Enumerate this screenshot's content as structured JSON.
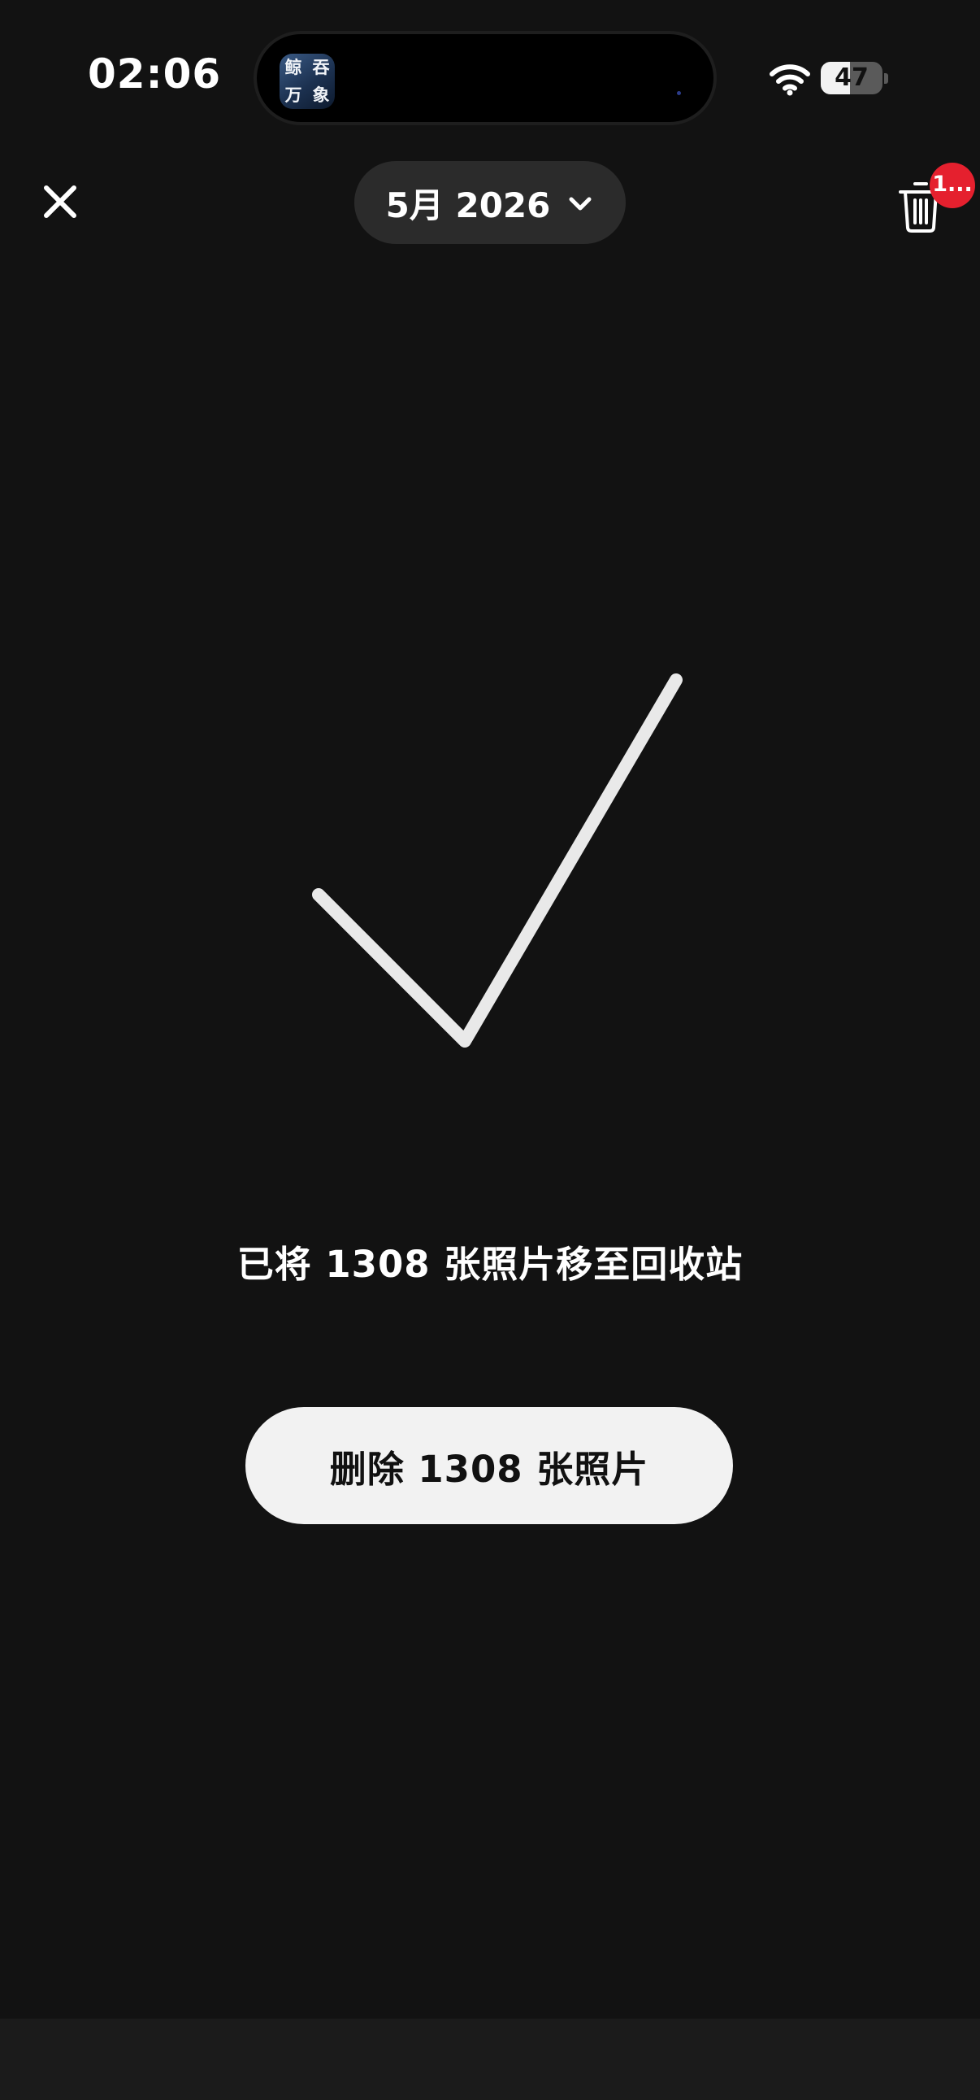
{
  "status_bar": {
    "time": "02:06",
    "island_app_icon_text": [
      "鲸",
      "吞",
      "万",
      "象"
    ],
    "battery_level": "47",
    "battery_fraction": 0.47
  },
  "header": {
    "month_label": "5月 2026",
    "trash_badge": "1..."
  },
  "main": {
    "message": "已将 1308 张照片移至回收站",
    "delete_button_label": "删除 1308 张照片"
  },
  "icons": {
    "close": "close-icon",
    "chevron": "chevron-down-icon",
    "trash": "trash-icon",
    "check": "checkmark-icon",
    "wifi": "wifi-icon"
  },
  "colors": {
    "background": "#121212",
    "pill": "#2b2b2b",
    "badge": "#e5202e",
    "button": "#f2f2f2",
    "checkmark": "#e9e9e9"
  }
}
